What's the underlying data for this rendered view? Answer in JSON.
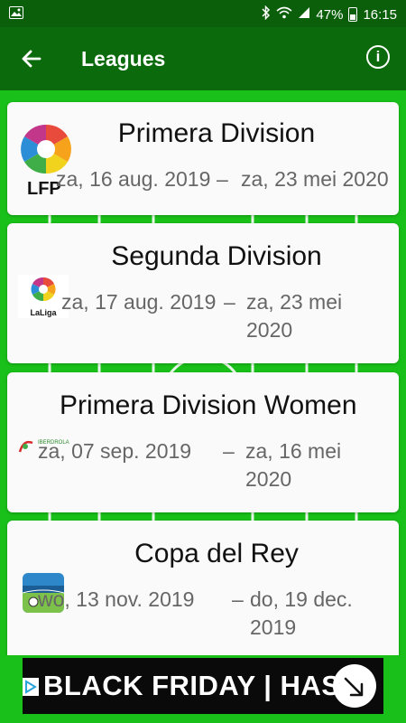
{
  "status_bar": {
    "battery": "47%",
    "time": "16:15"
  },
  "app_bar": {
    "title": "Leagues"
  },
  "leagues": [
    {
      "name": "Primera Division",
      "start": "za, 16 aug. 2019",
      "separator": "–",
      "end": "za, 23 mei 2020",
      "logo_text": "LFP"
    },
    {
      "name": "Segunda Division",
      "start": "za, 17 aug. 2019",
      "separator": "–",
      "end": "za, 23 mei 2020",
      "logo_text": "LaLiga"
    },
    {
      "name": "Primera Division Women",
      "start": "za, 07 sep. 2019",
      "separator": "–",
      "end": "za, 16 mei 2020",
      "logo_text": "IBERDROLA"
    },
    {
      "name": "Copa del Rey",
      "start": "wo, 13 nov. 2019",
      "separator": "–",
      "end": "do, 19 dec. 2019",
      "logo_text": ""
    }
  ],
  "ad": {
    "text": "BLACK FRIDAY | HAS"
  },
  "colors": {
    "status_bar": "#0b5f0b",
    "app_bar": "#0b6a0b",
    "field": "#19c019"
  }
}
